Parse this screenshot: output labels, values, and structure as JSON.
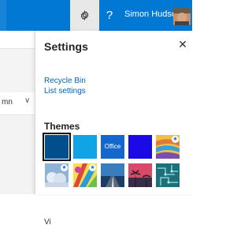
{
  "topbar": {
    "user_name": "Simon Hudson",
    "help_glyph": "?",
    "gear_icon": "gear-icon",
    "brand_color": "#0078d4"
  },
  "background": {
    "column_label": "mn",
    "chevron": "∨"
  },
  "settings": {
    "title": "Settings",
    "close_glyph": "✕",
    "links": [
      "Recycle Bin",
      "List settings"
    ],
    "themes_title": "Themes",
    "themes": [
      {
        "name": "dark-blue",
        "color": "#004e8c",
        "selected": true
      },
      {
        "name": "light-blue",
        "color": "#10a3e6"
      },
      {
        "name": "office",
        "color": "#1468cc",
        "label": "Office"
      },
      {
        "name": "bright-blue",
        "color": "#1a0be6"
      },
      {
        "name": "sunset-stripes",
        "starred": true
      },
      {
        "name": "sky-clouds",
        "starred": true
      },
      {
        "name": "colorful-abstract",
        "starred": true
      },
      {
        "name": "blue-road"
      },
      {
        "name": "palm-sunset"
      },
      {
        "name": "circuit-board"
      }
    ],
    "cut_off_text": "Vi"
  }
}
